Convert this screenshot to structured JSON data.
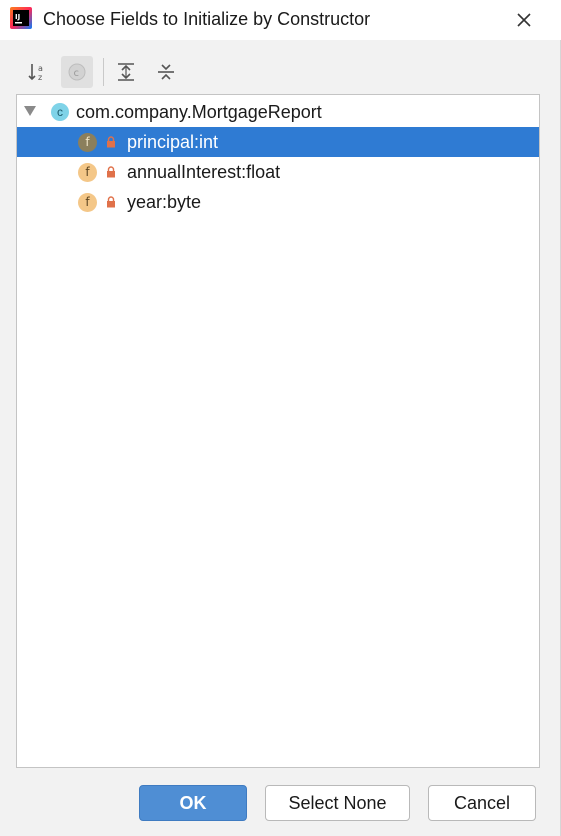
{
  "window": {
    "title": "Choose Fields to Initialize by Constructor",
    "app_icon_text": "IJ"
  },
  "toolbar": {
    "buttons": [
      {
        "name": "sort-alphabetically",
        "icon": "sort-az-icon",
        "enabled": true
      },
      {
        "name": "show-classes",
        "icon": "class-c-icon",
        "enabled": false
      },
      {
        "name": "expand-all",
        "icon": "expand-all-icon",
        "enabled": true
      },
      {
        "name": "collapse-all",
        "icon": "collapse-all-icon",
        "enabled": true
      }
    ],
    "disabled_icon_letter": "c"
  },
  "tree": {
    "root": {
      "label": "com.company.MortgageReport",
      "icon_letter": "c",
      "expanded": true
    },
    "fields": [
      {
        "label": "principal:int",
        "icon_letter": "f",
        "selected": true
      },
      {
        "label": "annualInterest:float",
        "icon_letter": "f",
        "selected": false
      },
      {
        "label": "year:byte",
        "icon_letter": "f",
        "selected": false
      }
    ]
  },
  "buttons": {
    "ok": "OK",
    "select_none": "Select None",
    "cancel": "Cancel"
  },
  "colors": {
    "selection": "#2f7bd3",
    "ok_button": "#4f8ed4",
    "field_icon": "#f4c788",
    "class_icon": "#7fd3e8",
    "lock": "#e0714a"
  }
}
